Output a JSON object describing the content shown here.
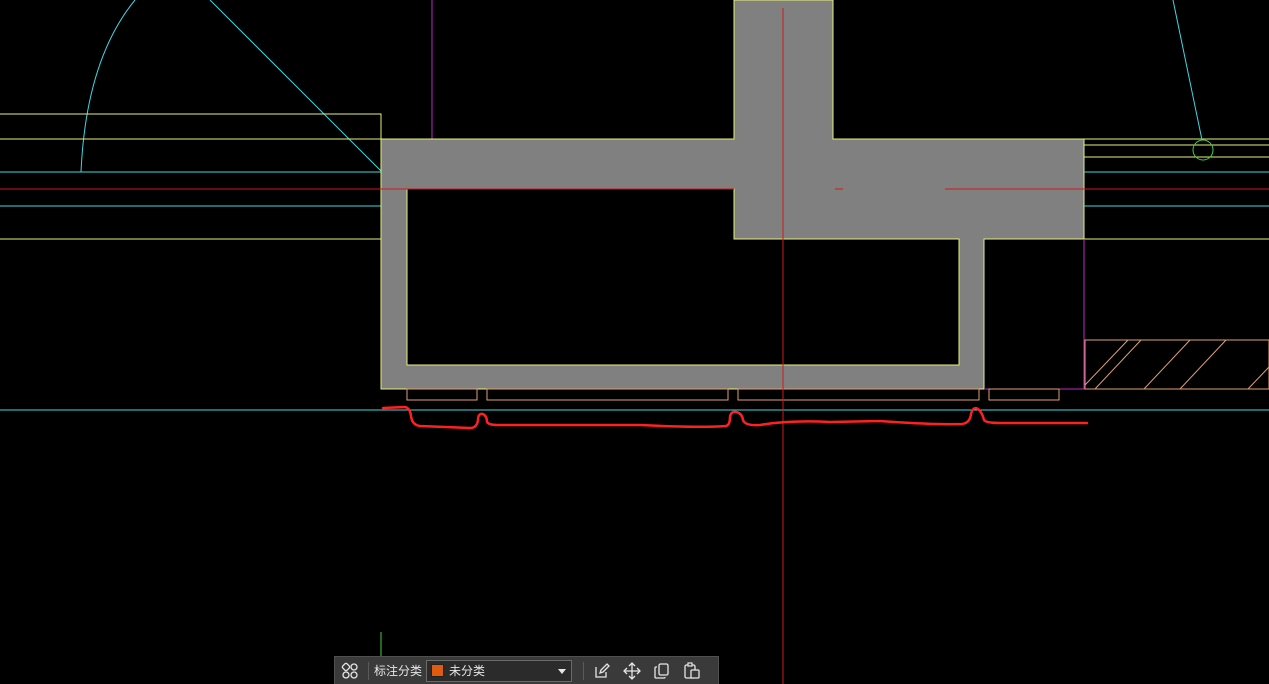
{
  "colors": {
    "background": "#000000",
    "wall_fill": "#808080",
    "outline_yellow": "#e6f07a",
    "cyan": "#3fd7e6",
    "red_axis": "#d01818",
    "magenta": "#c028c8",
    "hatch_orange": "#e0a070",
    "markup_red": "#ff2020",
    "green": "#40d040",
    "category_swatch": "#e05a10"
  },
  "toolbar": {
    "category_label": "标注分类",
    "category_value": "未分类",
    "icons": {
      "markup_panel": "markup-panel-icon",
      "edit": "edit-icon",
      "move": "move-icon",
      "copy": "copy-icon",
      "paste": "paste-icon",
      "dropdown": "chevron-down-icon"
    }
  }
}
